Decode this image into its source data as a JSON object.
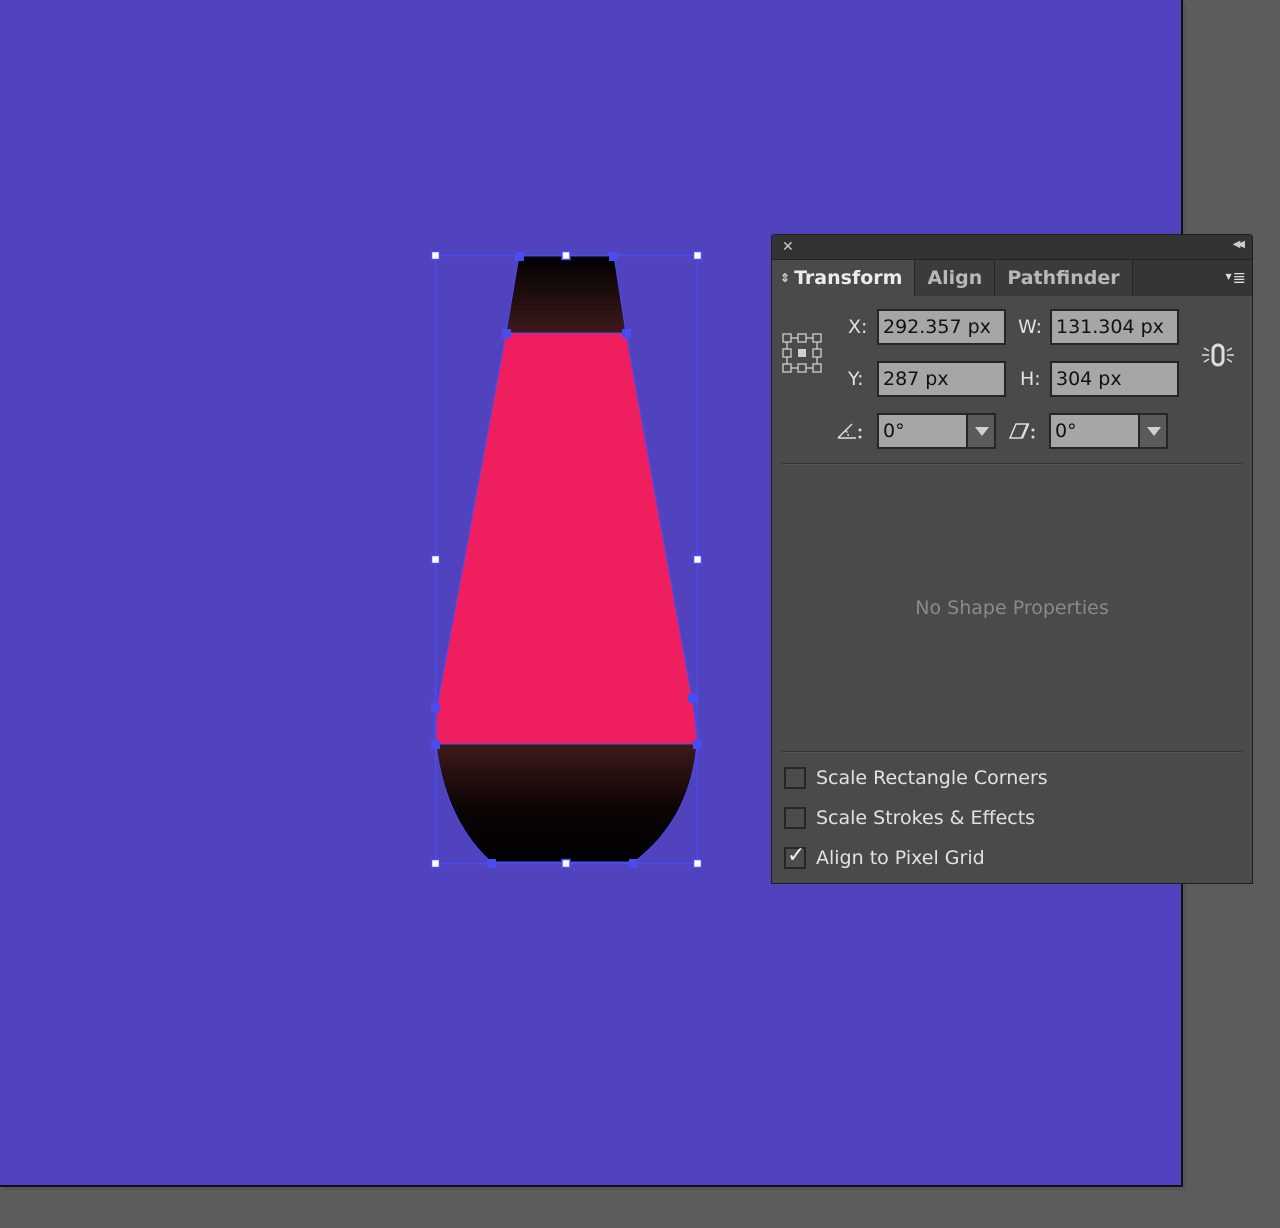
{
  "canvas": {
    "artboard_color": "#5142bd",
    "pasteboard_color": "#5c5c5c",
    "selection_color": "#4a4cf0",
    "shape": {
      "name": "lava-lamp",
      "cap_gradient": [
        "#000000",
        "#3e1a1a"
      ],
      "body_color": "#ef1f5f",
      "base_gradient": [
        "#3e1a1a",
        "#000000"
      ]
    }
  },
  "panel": {
    "tabs": [
      {
        "label": "Transform",
        "active": true
      },
      {
        "label": "Align",
        "active": false
      },
      {
        "label": "Pathfinder",
        "active": false
      }
    ],
    "fields": {
      "x_label": "X:",
      "x_value": "292.357 px",
      "y_label": "Y:",
      "y_value": "287 px",
      "w_label": "W:",
      "w_value": "131.304 px",
      "h_label": "H:",
      "h_value": "304 px",
      "rotate_label": ":",
      "rotate_value": "0°",
      "shear_label": ":",
      "shear_value": "0°"
    },
    "constrain_proportions": false,
    "no_shape_properties": "No Shape Properties",
    "options": [
      {
        "label": "Scale Rectangle Corners",
        "checked": false
      },
      {
        "label": "Scale Strokes & Effects",
        "checked": false
      },
      {
        "label": "Align to Pixel Grid",
        "checked": true
      }
    ],
    "icons": {
      "close": "✕",
      "collapse": "◀◀",
      "menu": "≣",
      "checkmark": "✓"
    }
  }
}
